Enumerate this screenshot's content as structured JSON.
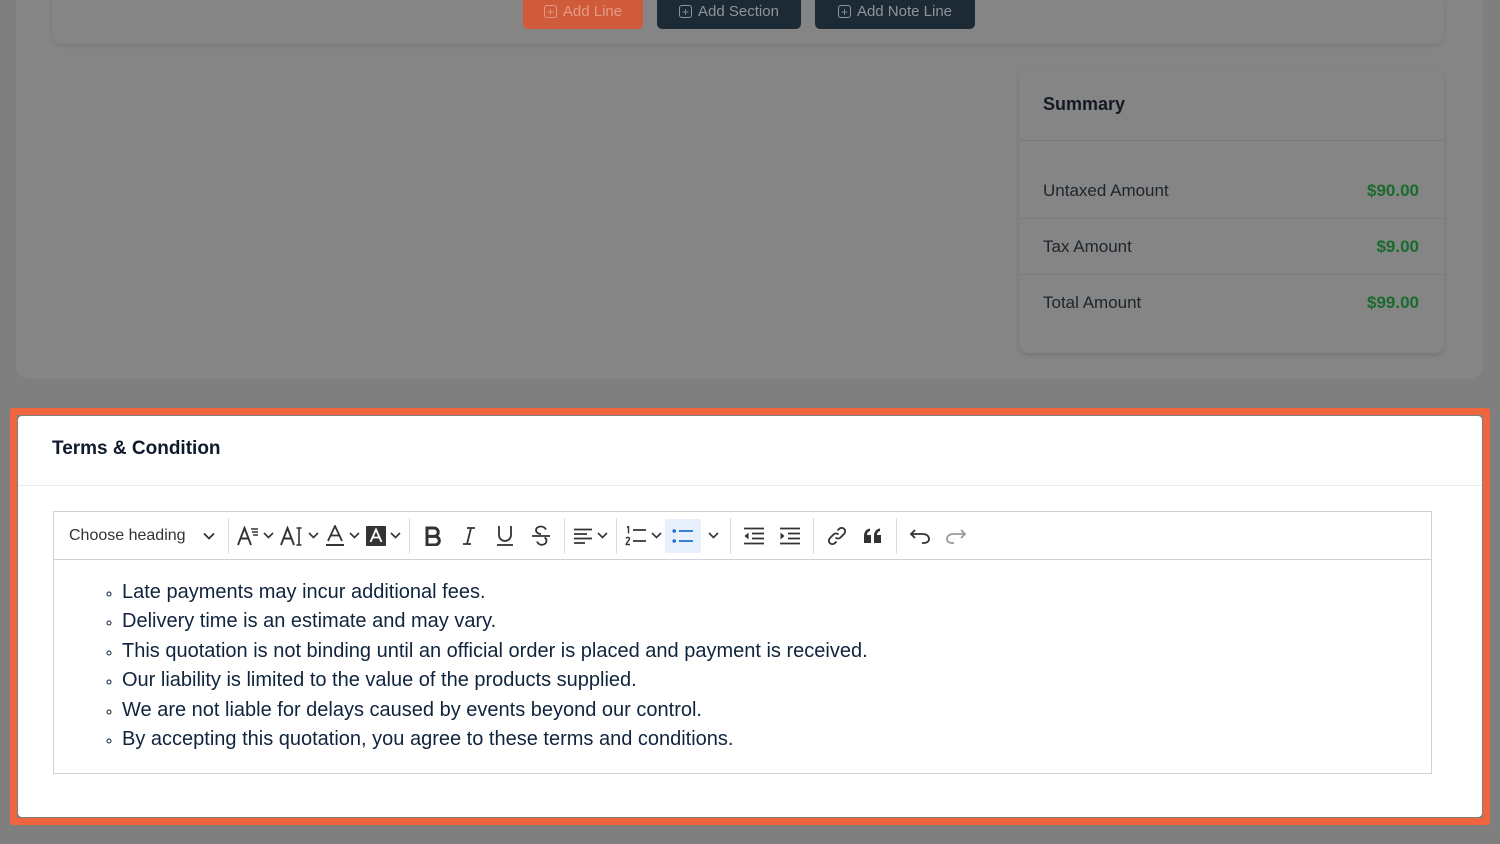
{
  "line_actions": {
    "add_line": "Add Line",
    "add_section": "Add Section",
    "add_note_line": "Add Note Line"
  },
  "summary": {
    "title": "Summary",
    "rows": [
      {
        "label": "Untaxed Amount",
        "value": "$90.00"
      },
      {
        "label": "Tax Amount",
        "value": "$9.00"
      },
      {
        "label": "Total Amount",
        "value": "$99.00"
      }
    ]
  },
  "terms": {
    "title": "Terms & Condition",
    "toolbar": {
      "heading_select": "Choose heading"
    },
    "items": [
      "Late payments may incur additional fees.",
      "Delivery time is an estimate and may vary.",
      "This quotation is not binding until an official order is placed and payment is received.",
      "Our liability is limited to the value of the products supplied.",
      "We are not liable for delays caused by events beyond our control.",
      "By accepting this quotation, you agree to these terms and conditions."
    ]
  },
  "colors": {
    "accent": "#f0643e",
    "amount_green": "#186b2c",
    "dark_button": "#1c2a36"
  }
}
